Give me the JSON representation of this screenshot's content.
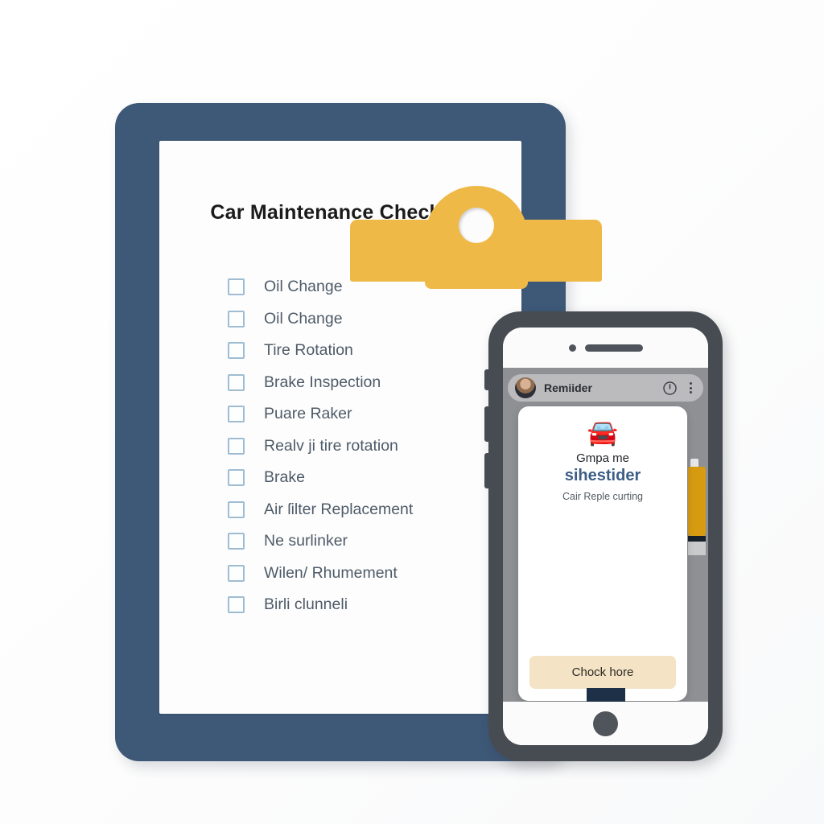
{
  "scene": {
    "background_color": "#ffffff"
  },
  "clipboard": {
    "board_color": "#3e5877",
    "clip_color": "#efb947",
    "paper_color": "#fdfdfd",
    "title": "Car Maintenance Checklist",
    "checkbox_color": "#9fbdd2",
    "item_text_color": "#4e5b68",
    "items": [
      {
        "label": "Oil Change",
        "checked": false
      },
      {
        "label": "Oil Change",
        "checked": false
      },
      {
        "label": "Tire Rotation",
        "checked": false
      },
      {
        "label": "Brake Inspection",
        "checked": false
      },
      {
        "label": "Puare Raker",
        "checked": false
      },
      {
        "label": "Realv ji tire rotation",
        "checked": false
      },
      {
        "label": "Brake",
        "checked": false
      },
      {
        "label": "Air ſilter Replacement",
        "checked": false
      },
      {
        "label": "Ne surlinker",
        "checked": false
      },
      {
        "label": "Wilen/ Rhumement",
        "checked": false
      },
      {
        "label": "Birli clunneli",
        "checked": false
      }
    ]
  },
  "phone": {
    "frame_color": "#474b52",
    "screen_background": "#8e9094",
    "app_header": {
      "title": "Remiider",
      "avatar_icon": "user-avatar-photo",
      "power_icon": "power-icon",
      "menu_icon": "more-vertical-icon"
    },
    "notification_card": {
      "image_icon": "yellow-car-emoji",
      "image_glyph": "🚘",
      "line1": "Gmpa me",
      "line2": "sihestider",
      "line2_color": "#3c5e86",
      "line3": "Cair Reple curting",
      "button_label": "Chock hore",
      "button_color": "#f4e3c4"
    },
    "background_object": "oil-bottle-graphic",
    "home_button_icon": "home-button"
  }
}
